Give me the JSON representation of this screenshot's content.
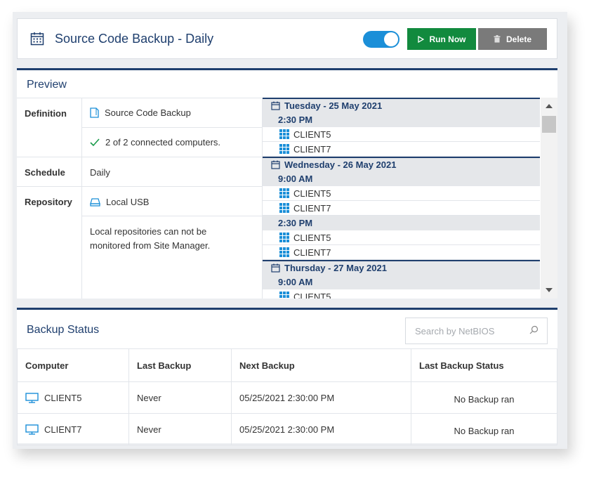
{
  "header": {
    "title": "Source Code Backup - Daily",
    "toggle_on": true,
    "run_label": "Run Now",
    "delete_label": "Delete"
  },
  "preview": {
    "title": "Preview",
    "definition_label": "Definition",
    "definition_value": "Source Code Backup",
    "connected_text": "2 of 2 connected computers.",
    "schedule_label": "Schedule",
    "schedule_value": "Daily",
    "repository_label": "Repository",
    "repository_value": "Local USB",
    "repository_note": "Local repositories can not be monitored from Site Manager.",
    "schedule_list": [
      {
        "day": "Tuesday - 25 May 2021"
      },
      {
        "time": "2:30 PM"
      },
      {
        "client": "CLIENT5"
      },
      {
        "client": "CLIENT7"
      },
      {
        "day": "Wednesday - 26 May 2021"
      },
      {
        "time": "9:00 AM"
      },
      {
        "client": "CLIENT5"
      },
      {
        "client": "CLIENT7"
      },
      {
        "time": "2:30 PM"
      },
      {
        "client": "CLIENT5"
      },
      {
        "client": "CLIENT7"
      },
      {
        "day": "Thursday - 27 May 2021"
      },
      {
        "time": "9:00 AM"
      },
      {
        "client": "CLIENT5"
      }
    ]
  },
  "status": {
    "title": "Backup Status",
    "search_placeholder": "Search by NetBIOS",
    "columns": [
      "Computer",
      "Last Backup",
      "Next Backup",
      "Last Backup Status"
    ],
    "rows": [
      {
        "computer": "CLIENT5",
        "last": "Never",
        "next": "05/25/2021 2:30:00 PM",
        "status": "No Backup ran"
      },
      {
        "computer": "CLIENT7",
        "last": "Never",
        "next": "05/25/2021 2:30:00 PM",
        "status": "No Backup ran"
      }
    ]
  },
  "colors": {
    "primary": "#1f3f6e",
    "toggle": "#1b8fd8",
    "run": "#128a3e",
    "delete": "#7a7a7a",
    "icon": "#1b8fd8"
  }
}
